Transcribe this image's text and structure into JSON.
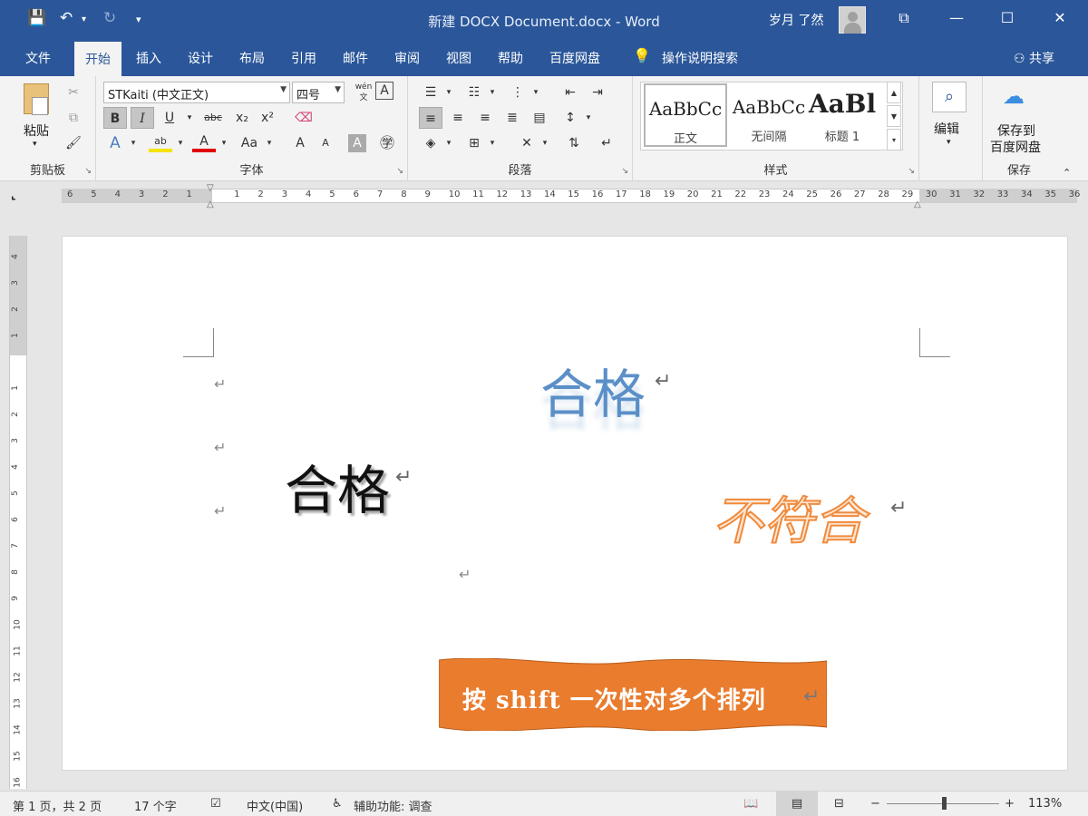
{
  "titlebar": {
    "title": "新建 DOCX Document.docx  -  Word",
    "user": "岁月 了然",
    "save_icon": "💾",
    "undo_icon": "↶",
    "redo_icon": "↻",
    "customize_icon": "▾",
    "ribbon_display_icon": "⧉",
    "minimize_icon": "—",
    "maximize_icon": "☐",
    "close_icon": "✕"
  },
  "tabs": [
    "文件",
    "开始",
    "插入",
    "设计",
    "布局",
    "引用",
    "邮件",
    "审阅",
    "视图",
    "帮助",
    "百度网盘"
  ],
  "tell_me": "操作说明搜索",
  "share": "共享",
  "ribbon": {
    "clipboard": {
      "label": "剪贴板",
      "paste": "粘贴"
    },
    "font": {
      "label": "字体",
      "font_name": "STKaiti (中文正文)",
      "font_size": "四号",
      "bold": "B",
      "italic": "I",
      "underline": "U",
      "strike": "abc",
      "subscript": "x₂",
      "superscript": "x²",
      "grow": "A",
      "shrink": "A",
      "case": "Aa"
    },
    "paragraph": {
      "label": "段落"
    },
    "styles": {
      "label": "样式",
      "items": [
        {
          "preview": "AaBbCc",
          "name": "正文"
        },
        {
          "preview": "AaBbCc",
          "name": "无间隔"
        },
        {
          "preview": "AaBl",
          "name": "标题 1"
        }
      ]
    },
    "editing": {
      "label": "编辑"
    },
    "save": {
      "label": "保存",
      "button_line1": "保存到",
      "button_line2": "百度网盘"
    }
  },
  "ruler": {
    "h_labels": [
      "6",
      "5",
      "4",
      "3",
      "2",
      "1",
      "",
      "1",
      "2",
      "3",
      "4",
      "5",
      "6",
      "7",
      "8",
      "9",
      "10",
      "11",
      "12",
      "13",
      "14",
      "15",
      "16",
      "17",
      "18",
      "19",
      "20",
      "21",
      "22",
      "23",
      "24",
      "25",
      "26",
      "27",
      "28",
      "29",
      "30",
      "31",
      "32",
      "33",
      "34",
      "35",
      "36"
    ],
    "v_labels": [
      "4",
      "3",
      "2",
      "1",
      "",
      "1",
      "2",
      "3",
      "4",
      "5",
      "6",
      "7",
      "8",
      "9",
      "10",
      "11",
      "12",
      "13",
      "14",
      "15",
      "16"
    ]
  },
  "document": {
    "pilcrow": "↵",
    "wordart_blue": "合格",
    "wordart_black": "合格",
    "wordart_orange": "不符合",
    "banner_text": "按 shift 一次性对多个排列"
  },
  "statusbar": {
    "page": "第 1 页，共 2 页",
    "words": "17 个字",
    "language": "中文(中国)",
    "accessibility": "辅助功能: 调查",
    "zoom": "113%",
    "zoom_out": "−",
    "zoom_in": "+"
  },
  "colors": {
    "accent": "#2b579a",
    "wordart_blue": "#5b8fc7",
    "wordart_orange": "#f08a3c",
    "banner": "#ea7c2e"
  }
}
